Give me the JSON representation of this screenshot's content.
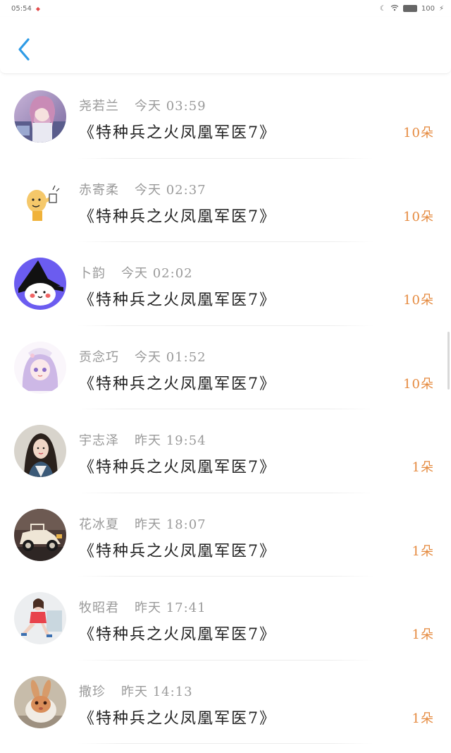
{
  "status_bar": {
    "time": "05:54",
    "notification_icon": "red-dot-icon",
    "battery_text": "100",
    "icons": [
      "moon-icon",
      "wifi-icon",
      "battery-icon",
      "charging-icon"
    ]
  },
  "header": {
    "back_icon": "chevron-left-icon",
    "accent_color": "#2e9be6"
  },
  "count_color": "#e58a3f",
  "gifts": [
    {
      "name": "尧若兰",
      "time": "今天 03:59",
      "message": "《特种兵之火凤凰军医7》",
      "count": "10朵",
      "avatar": "anime-girl-purple"
    },
    {
      "name": "赤寄柔",
      "time": "今天 02:37",
      "message": "《特种兵之火凤凰军医7》",
      "count": "10朵",
      "avatar": "cartoon-bald-man"
    },
    {
      "name": "卜韵",
      "time": "今天 02:02",
      "message": "《特种兵之火凤凰军医7》",
      "count": "10朵",
      "avatar": "witch-cat-cartoon"
    },
    {
      "name": "贡念巧",
      "time": "今天 01:52",
      "message": "《特种兵之火凤凰军医7》",
      "count": "10朵",
      "avatar": "anime-girl-lavender"
    },
    {
      "name": "宇志泽",
      "time": "昨天 19:54",
      "message": "《特种兵之火凤凰军医7》",
      "count": "1朵",
      "avatar": "woman-portrait"
    },
    {
      "name": "花冰夏",
      "time": "昨天 18:07",
      "message": "《特种兵之火凤凰军医7》",
      "count": "1朵",
      "avatar": "vintage-car"
    },
    {
      "name": "牧昭君",
      "time": "昨天 17:41",
      "message": "《特种兵之火凤凰军医7》",
      "count": "1朵",
      "avatar": "woman-full-body"
    },
    {
      "name": "撒珍",
      "time": "昨天 14:13",
      "message": "《特种兵之火凤凰军医7》",
      "count": "1朵",
      "avatar": "rabbit-photo"
    }
  ]
}
